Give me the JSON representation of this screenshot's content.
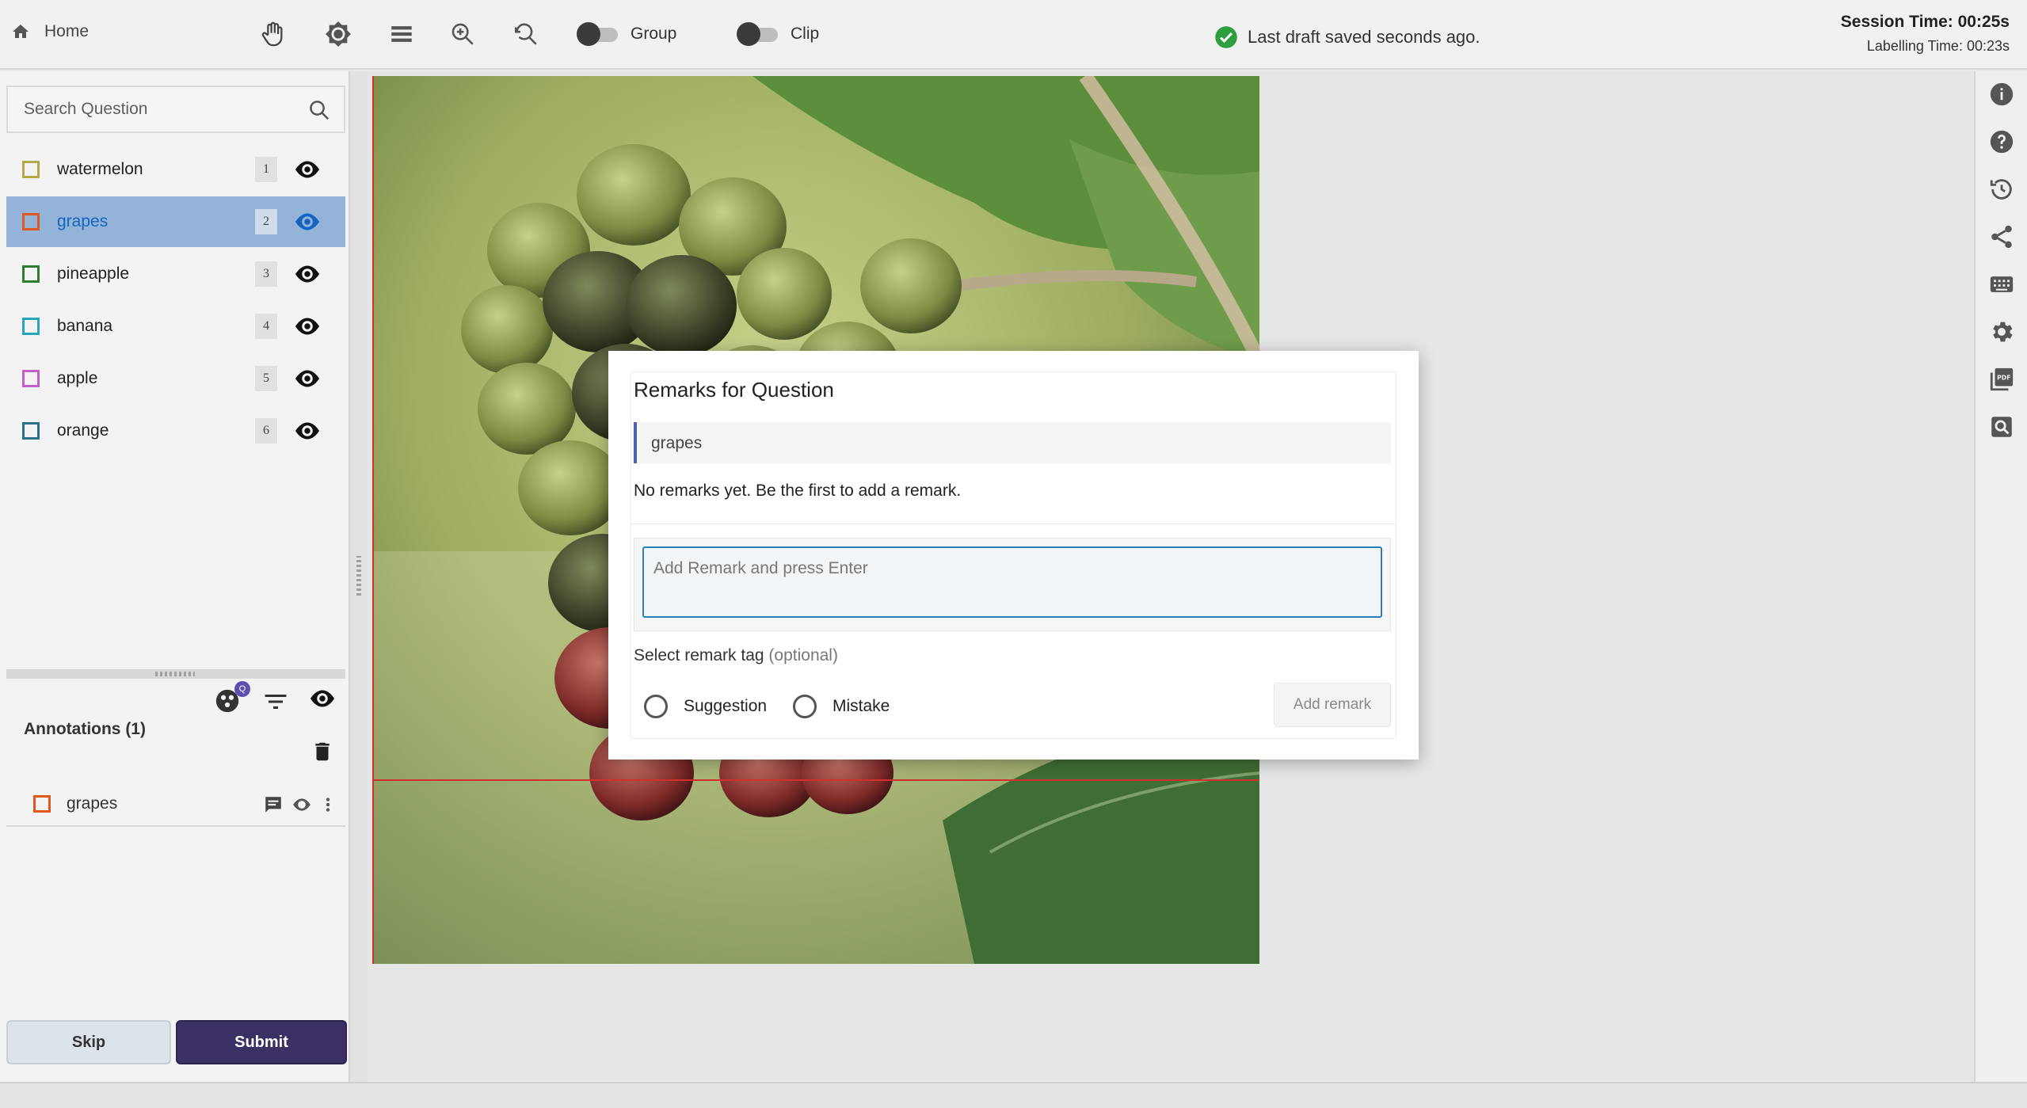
{
  "topbar": {
    "home_label": "Home",
    "group_label": "Group",
    "clip_label": "Clip",
    "saved_text": "Last draft saved seconds ago.",
    "session_time": "Session Time: 00:25s",
    "labelling_time": "Labelling Time: 00:23s"
  },
  "search": {
    "placeholder": "Search Question"
  },
  "questions": [
    {
      "label": "watermelon",
      "num": "1",
      "color": "#b5a84a"
    },
    {
      "label": "grapes",
      "num": "2",
      "color": "#e0571f",
      "selected": true
    },
    {
      "label": "pineapple",
      "num": "3",
      "color": "#2e7d32"
    },
    {
      "label": "banana",
      "num": "4",
      "color": "#26a6b8"
    },
    {
      "label": "apple",
      "num": "5",
      "color": "#c060c8"
    },
    {
      "label": "orange",
      "num": "6",
      "color": "#2d6f8a"
    }
  ],
  "annotations": {
    "title": "Annotations (1)",
    "badge": "Q",
    "items": [
      {
        "label": "grapes",
        "color": "#e0571f"
      }
    ]
  },
  "buttons": {
    "skip": "Skip",
    "submit": "Submit"
  },
  "modal": {
    "title": "Remarks for Question",
    "question": "grapes",
    "empty_text": "No remarks yet. Be the first to add a remark.",
    "input_placeholder": "Add Remark and press Enter",
    "tag_label": "Select remark tag",
    "tag_optional": "(optional)",
    "options": [
      "Suggestion",
      "Mistake"
    ],
    "add_button": "Add remark"
  },
  "icons": {
    "toolbar": [
      "hand-icon",
      "brightness-icon",
      "layers-icon",
      "zoom-in-icon",
      "zoom-reset-icon"
    ],
    "rightbar": [
      "info-icon",
      "help-icon",
      "history-icon",
      "share-icon",
      "keyboard-icon",
      "settings-icon",
      "pdf-icon",
      "image-search-icon"
    ]
  },
  "colors": {
    "accent": "#3b2f63",
    "selected_row": "#93b3d8",
    "bbox": "#d32f2f",
    "saved_check": "#2e9e3e"
  }
}
